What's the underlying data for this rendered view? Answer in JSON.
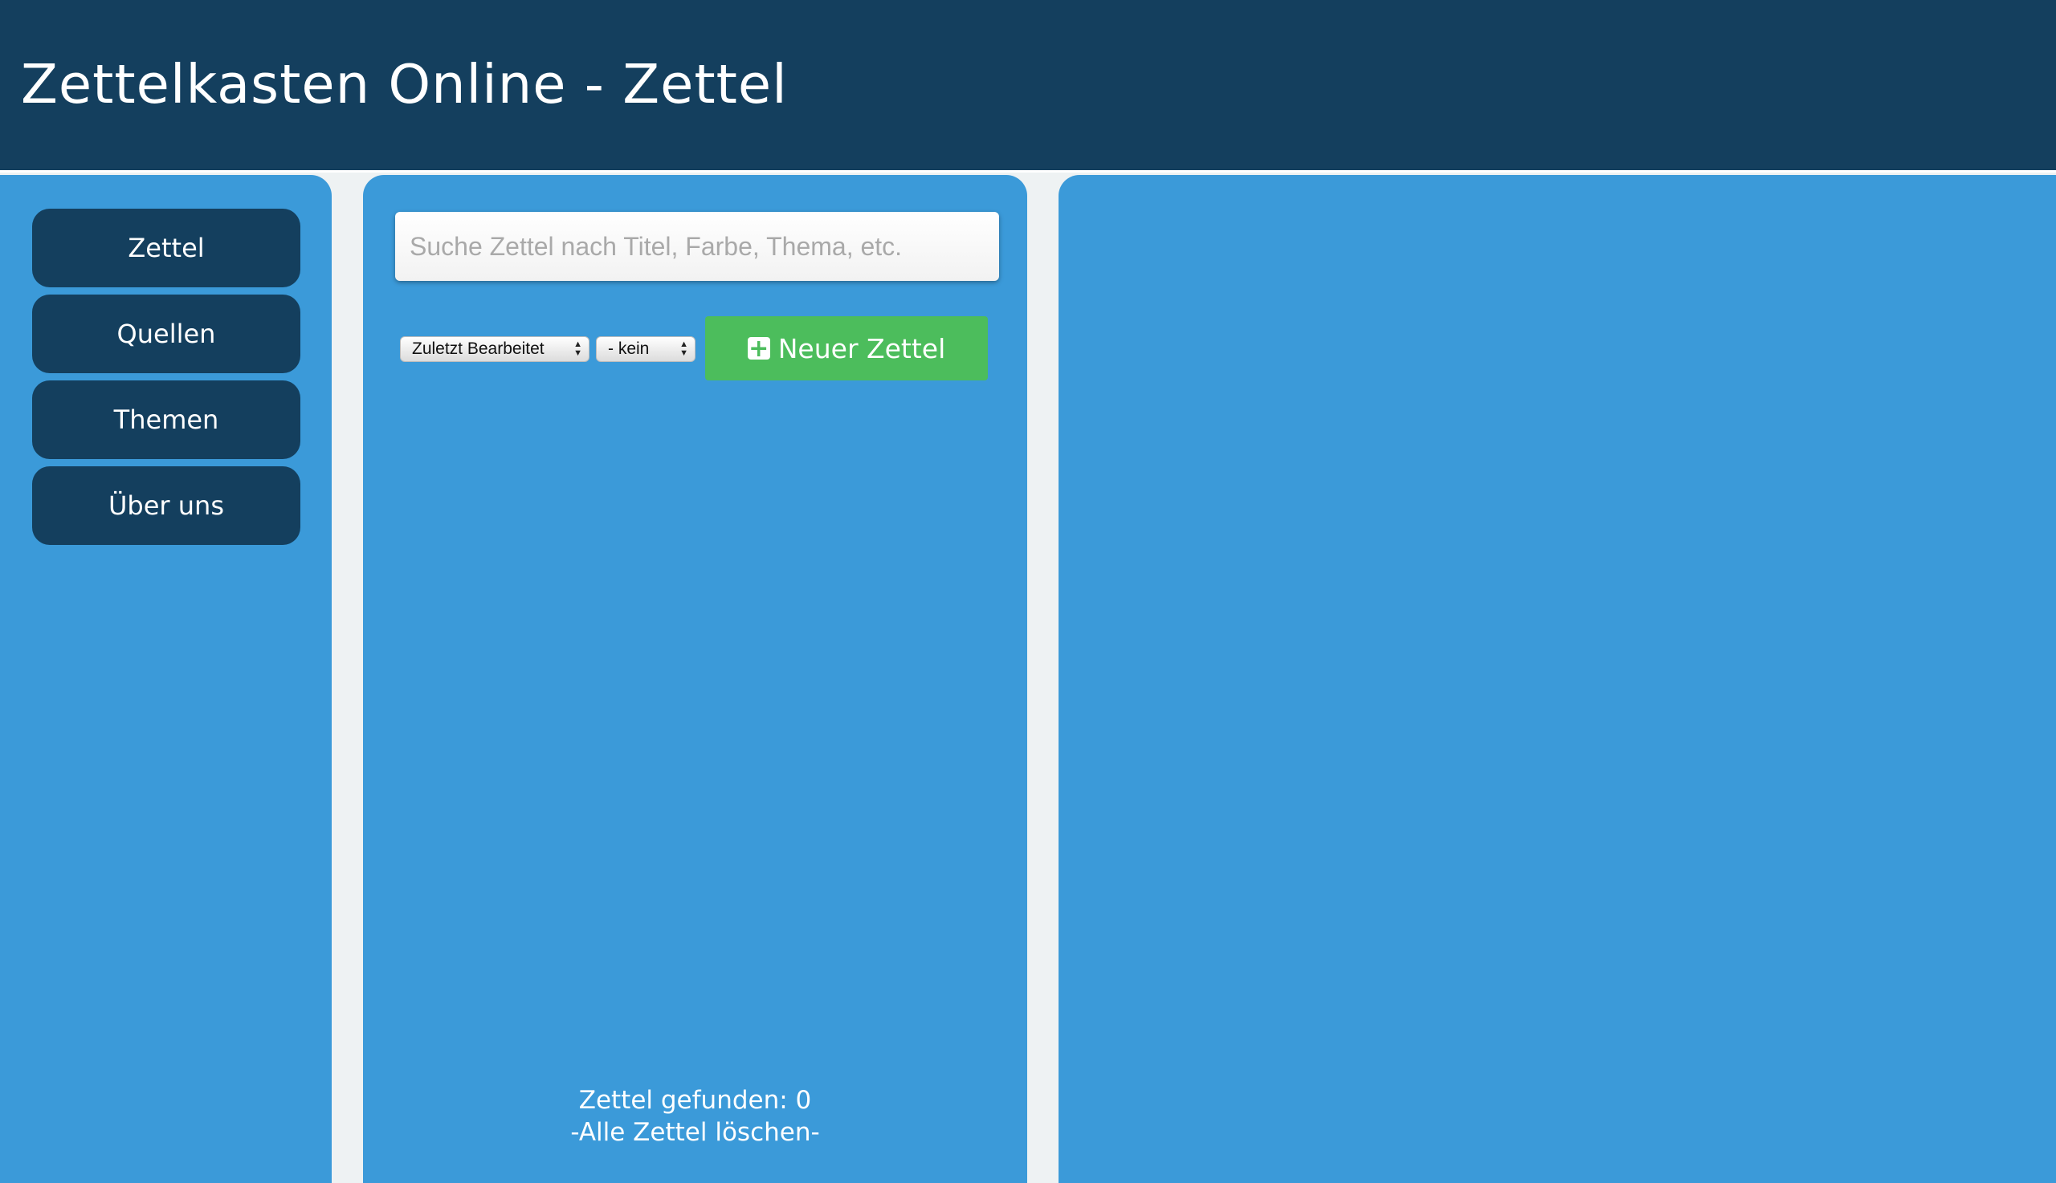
{
  "header": {
    "title": "Zettelkasten Online - Zettel"
  },
  "sidebar": {
    "items": [
      {
        "label": "Zettel"
      },
      {
        "label": "Quellen"
      },
      {
        "label": "Themen"
      },
      {
        "label": "Über uns"
      }
    ]
  },
  "notes": {
    "search_placeholder": "Suche Zettel nach Titel, Farbe, Thema, etc.",
    "sort_selected": "Zuletzt Bearbeitet",
    "filter_selected": "- kein",
    "new_button_label": "Neuer Zettel",
    "new_button_icon": "plus-square-icon",
    "found_label": "Zettel gefunden: 0",
    "delete_all_label": "-Alle Zettel löschen-"
  },
  "colors": {
    "header_bg": "#143f5e",
    "panel_bg": "#3b9ad9",
    "nav_button_bg": "#143f5e",
    "new_button_bg": "#4cbd5c",
    "page_bg": "#eef2f3"
  }
}
